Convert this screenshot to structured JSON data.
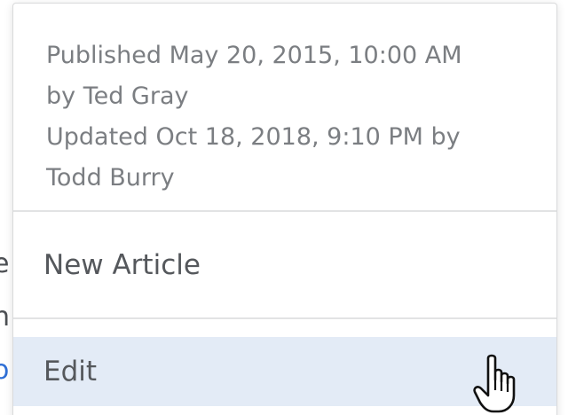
{
  "background": {
    "fragment_1": "e",
    "fragment_2": "n",
    "fragment_3": "o"
  },
  "popup": {
    "meta_lines": [
      "Published May 20, 2015, 10:00 AM",
      "by Ted Gray",
      "Updated Oct 18, 2018, 9:10 PM by",
      "Todd Burry"
    ],
    "items": [
      {
        "label": "New Article"
      },
      {
        "label": "Edit"
      }
    ]
  },
  "cursor": {
    "icon": "hand-pointer-icon"
  },
  "colors": {
    "hover_background": "#e3ebf6",
    "link": "#2f6fd6",
    "meta_text": "#7b7e82",
    "item_text": "#55585c"
  }
}
